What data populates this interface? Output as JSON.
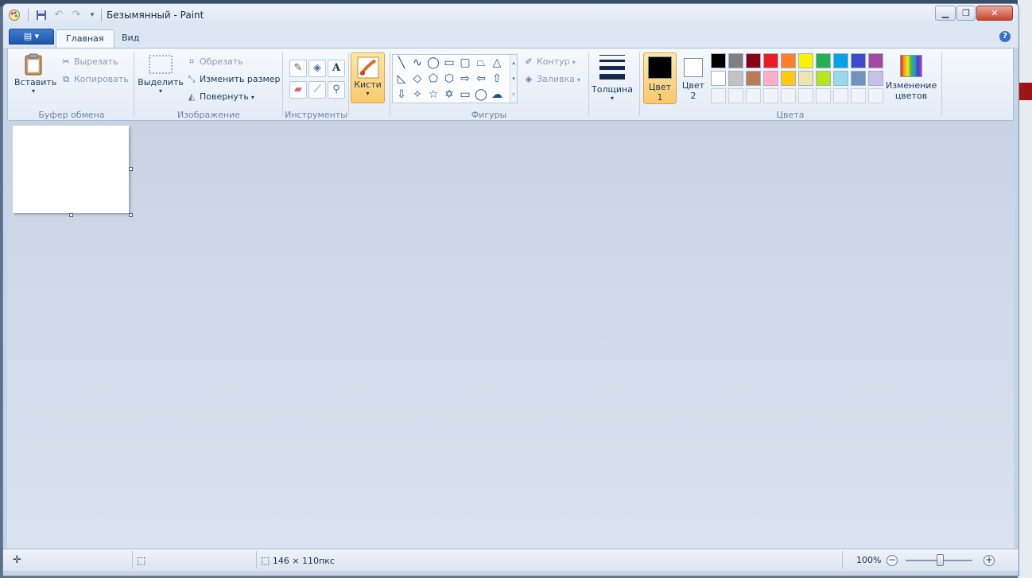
{
  "window": {
    "title": "Безымянный - Paint"
  },
  "tabs": [
    {
      "label": "Главная"
    },
    {
      "label": "Вид"
    }
  ],
  "ribbon": {
    "clipboard": {
      "paste": "Вставить",
      "cut": "Вырезать",
      "copy": "Копировать",
      "group": "Буфер обмена"
    },
    "image": {
      "select": "Выделить",
      "crop": "Обрезать",
      "resize": "Изменить размер",
      "rotate": "Повернуть",
      "group": "Изображение"
    },
    "tools": {
      "group": "Инструменты"
    },
    "brushes": {
      "label": "Кисти"
    },
    "shapes": {
      "outline": "Контур",
      "fill": "Заливка",
      "group": "Фигуры"
    },
    "size": {
      "label": "Толщина"
    },
    "colors": {
      "color1_line1": "Цвет",
      "color1_line2": "1",
      "color2_line1": "Цвет",
      "color2_line2": "2",
      "edit_line1": "Изменение",
      "edit_line2": "цветов",
      "group": "Цвета",
      "color1_value": "#000000",
      "color2_value": "#ffffff",
      "palette_row1": [
        "#000000",
        "#7f7f7f",
        "#880015",
        "#ed1c24",
        "#ff7f27",
        "#fff200",
        "#22b14c",
        "#00a2e8",
        "#3f48cc",
        "#a349a4"
      ],
      "palette_row2": [
        "#ffffff",
        "#c3c3c3",
        "#b97a57",
        "#ffaec9",
        "#ffc90e",
        "#efe4b0",
        "#b5e61d",
        "#99d9ea",
        "#7092be",
        "#c8bfe7"
      ]
    }
  },
  "statusbar": {
    "image_size": "146 × 110пкс",
    "zoom": "100%"
  },
  "icons": {
    "app": "paint-app-icon",
    "save": "save-icon",
    "undo": "undo-icon",
    "redo": "redo-icon"
  }
}
